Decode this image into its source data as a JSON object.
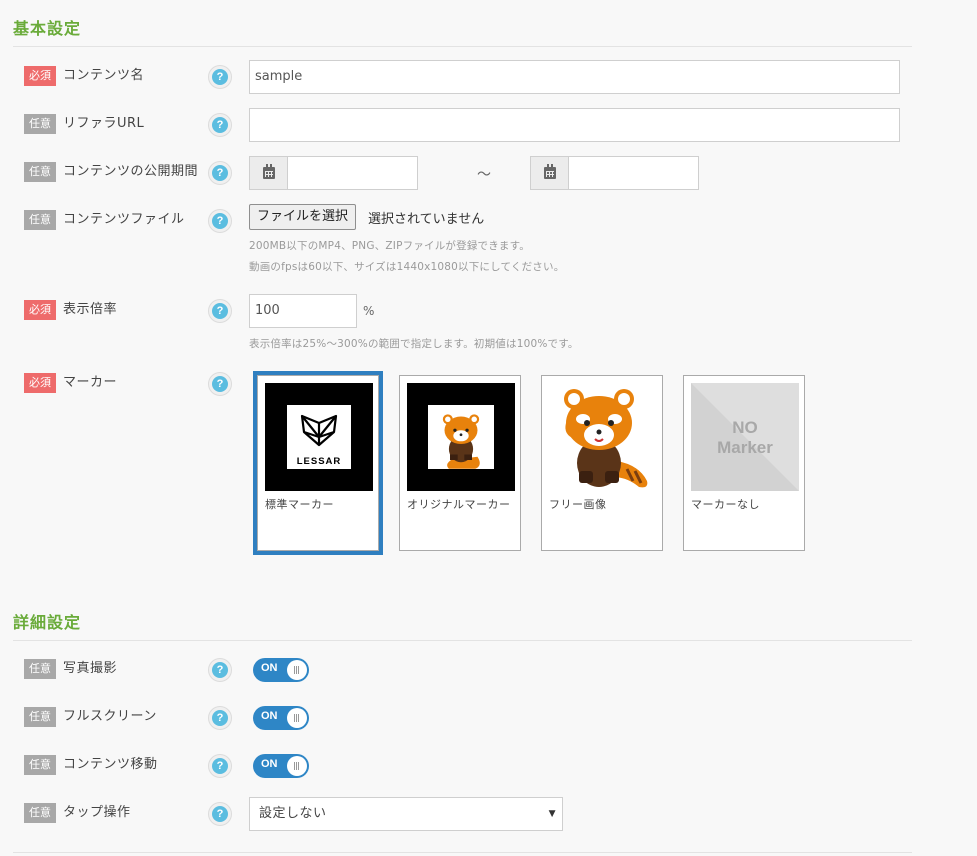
{
  "sections": {
    "basic_title": "基本設定",
    "detail_title": "詳細設定"
  },
  "badges": {
    "required": "必須",
    "optional": "任意"
  },
  "help_icon": "question-circle-icon",
  "fields": {
    "content_name": {
      "label": "コンテンツ名",
      "value": "sample"
    },
    "referrer_url": {
      "label": "リファラURL",
      "value": ""
    },
    "publish_period": {
      "label": "コンテンツの公開期間",
      "separator": "～",
      "start": "",
      "end": ""
    },
    "content_file": {
      "label": "コンテンツファイル",
      "button": "ファイルを選択",
      "status": "選択されていません",
      "hint1": "200MB以下のMP4、PNG、ZIPファイルが登録できます。",
      "hint2": "動画のfpsは60以下、サイズは1440x1080以下にしてください。"
    },
    "display_scale": {
      "label": "表示倍率",
      "value": "100",
      "unit": "%",
      "hint": "表示倍率は25%～300%の範囲で指定します。初期値は100%です。"
    },
    "marker": {
      "label": "マーカー",
      "options": [
        {
          "label": "標準マーカー",
          "logo_text": "LESSAR",
          "selected": true
        },
        {
          "label": "オリジナルマーカー",
          "selected": false
        },
        {
          "label": "フリー画像",
          "selected": false
        },
        {
          "label": "マーカーなし",
          "placeholder_line1": "NO",
          "placeholder_line2": "Marker",
          "selected": false
        }
      ]
    }
  },
  "details": {
    "photo": {
      "label": "写真撮影",
      "toggle": "ON",
      "on": true
    },
    "fullscreen": {
      "label": "フルスクリーン",
      "toggle": "ON",
      "on": true
    },
    "move": {
      "label": "コンテンツ移動",
      "toggle": "ON",
      "on": true
    },
    "tap": {
      "label": "タップ操作",
      "selected": "設定しない"
    }
  },
  "colors": {
    "section_title": "#6aab3a",
    "required_badge": "#ee6b6b",
    "optional_badge": "#a8a8a8",
    "help_icon": "#5bbde0",
    "toggle_on": "#2e86c6",
    "selected_marker_border": "#2f7fc0",
    "red_panda_fur": "#e8820c"
  }
}
